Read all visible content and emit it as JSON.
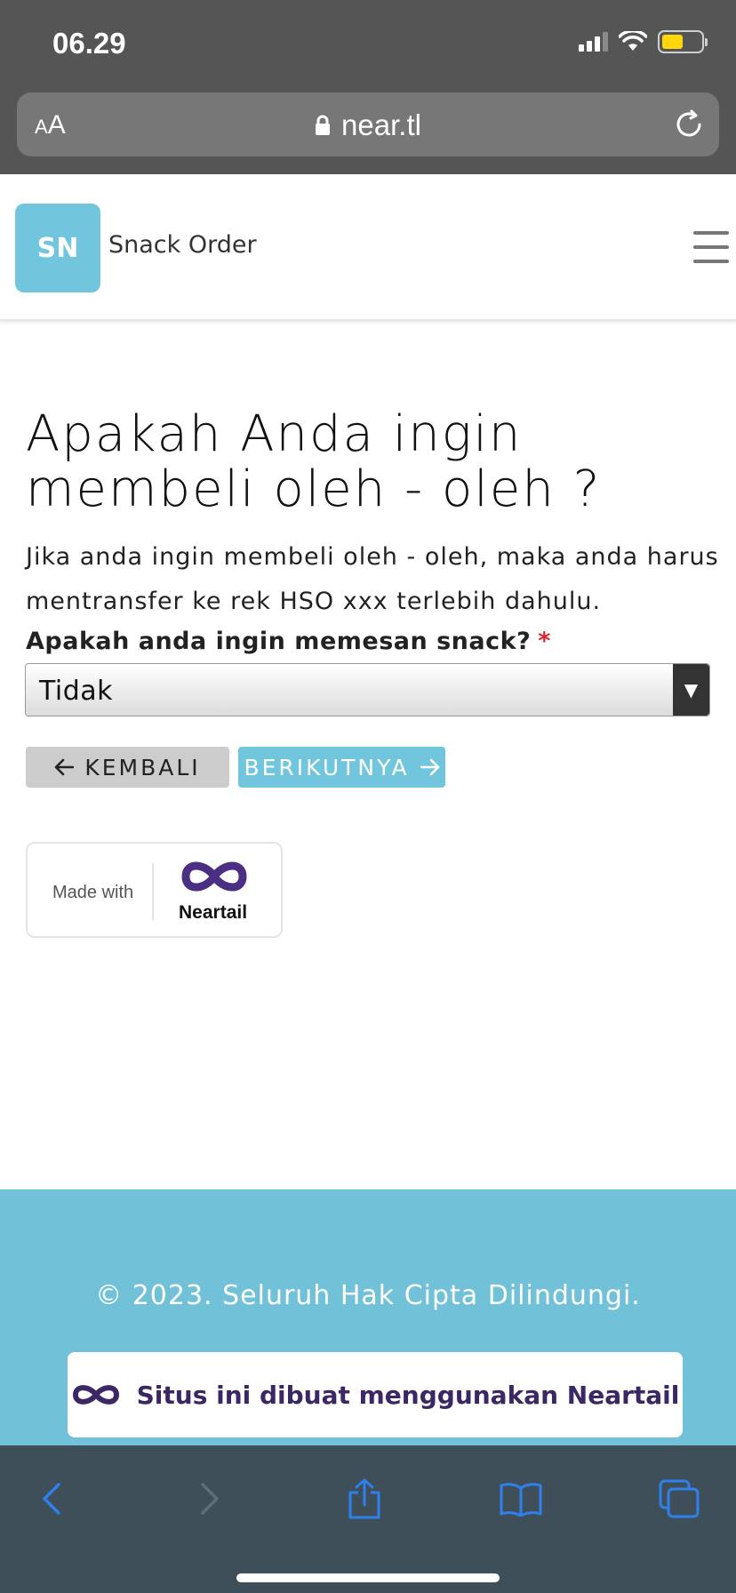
{
  "status_bar": {
    "time": "06.29"
  },
  "browser": {
    "text_size_small": "A",
    "text_size_large": "A",
    "url": "near.tl",
    "icons": [
      "lock-icon",
      "reload-icon",
      "back-icon",
      "forward-icon",
      "share-icon",
      "bookmarks-icon",
      "tabs-icon"
    ],
    "accent_color": "#2f80ed"
  },
  "header": {
    "logo_initials": "SN",
    "site_name": "Snack Order",
    "logo_color": "#71c6de"
  },
  "main": {
    "title": "Apakah Anda ingin membeli oleh - oleh ?",
    "description": "Jika anda ingin membeli oleh - oleh, maka anda harus mentransfer ke rek HSO xxx terlebih dahulu.",
    "question_label": "Apakah anda ingin memesan snack?",
    "required_mark": "*",
    "select_value": "Tidak",
    "back_button": "KEMBALI",
    "next_button": "BERIKUTNYA",
    "badge_made_with": "Made with",
    "badge_brand": "Neartail"
  },
  "footer": {
    "copyright": "© 2023. Seluruh Hak Cipta Dilindungi.",
    "badge_text": "Situs ini dibuat menggunakan Neartail",
    "background_color": "#71c1d8",
    "brand_color": "#3b2763"
  }
}
